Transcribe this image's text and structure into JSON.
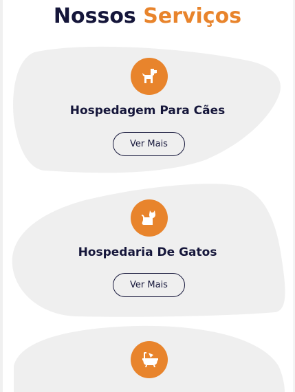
{
  "header": {
    "title_part_1": "Nossos",
    "title_part_2": "Serviços"
  },
  "colors": {
    "accent": "#e8842c",
    "dark": "#15163a",
    "blob": "#efefef"
  },
  "services": [
    {
      "title": "Hospedagem Para Cães",
      "button_label": "Ver Mais",
      "icon": "dog-icon"
    },
    {
      "title": "Hospedaria De Gatos",
      "button_label": "Ver Mais",
      "icon": "cat-icon"
    },
    {
      "icon": "bathtub-icon"
    }
  ]
}
